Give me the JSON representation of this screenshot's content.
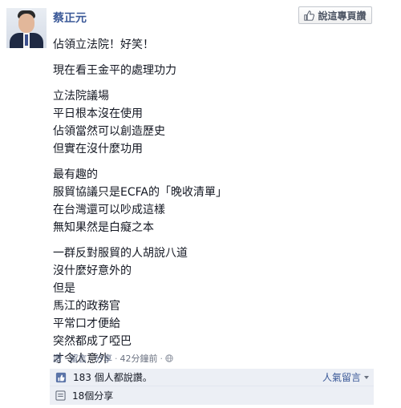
{
  "post": {
    "author": "蔡正元",
    "like_page_label": "說這專頁讚",
    "paragraphs": [
      [
        "佔領立法院！好笑！"
      ],
      [
        "現在看王金平的處理功力"
      ],
      [
        "立法院議場",
        "平日根本沒在使用",
        "佔領當然可以創造歷史",
        "但實在沒什麼功用"
      ],
      [
        "最有趣的",
        "服貿協議只是ECFA的「晚收清單」",
        "在台灣還可以吵成這樣",
        "無知果然是白癡之本"
      ],
      [
        "一群反對服貿的人胡說八道",
        "沒什麼好意外的",
        "但是",
        "馬江的政務官",
        "平常口才便給",
        "突然都成了啞巴",
        "才令人意外"
      ]
    ]
  },
  "actions": {
    "like": "讚",
    "comment": "留言",
    "share": "分享",
    "separator": "·",
    "timestamp": "42分鐘前",
    "privacy_icon": "globe-icon"
  },
  "likes": {
    "text": "183 個人都說讚。",
    "sort_label": "人氣留言"
  },
  "shares": {
    "text": "18個分享"
  },
  "colors": {
    "link": "#3b5998",
    "panel": "#eceff5"
  }
}
